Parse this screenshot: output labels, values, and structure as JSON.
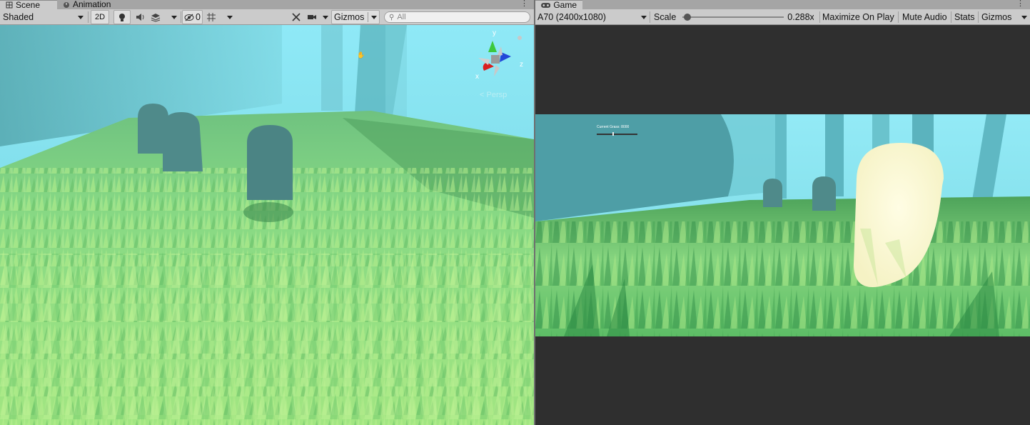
{
  "scene": {
    "tabs": [
      {
        "label": "Scene",
        "icon": "grid-icon",
        "active": true
      },
      {
        "label": "Animation",
        "icon": "clock-icon",
        "active": false
      }
    ],
    "toolbar": {
      "draw_mode": "Shaded",
      "mode_2d": "2D",
      "hidden_count": "0",
      "gizmos": "Gizmos",
      "search_placeholder": "All"
    },
    "axis": {
      "y": "y",
      "x": "x",
      "z": "z",
      "projection": "Persp"
    }
  },
  "game": {
    "tab": {
      "label": "Game",
      "icon": "gamepad-icon"
    },
    "toolbar": {
      "display": "A70 (2400x1080)",
      "scale_label": "Scale",
      "scale_value": "0.288x",
      "scale_fraction": 0.01,
      "maximize": "Maximize On Play",
      "mute": "Mute Audio",
      "stats": "Stats",
      "gizmos": "Gizmos"
    },
    "overlay_text": "Current Grass: 8000"
  },
  "colors": {
    "sky": "#8fe9f7",
    "grass_light": "#97e07a",
    "grass_dark": "#3e9e4e",
    "tombstone": "#4f8a8a",
    "glow": "#fbf9d2",
    "letterbox": "#2f2f2f"
  }
}
